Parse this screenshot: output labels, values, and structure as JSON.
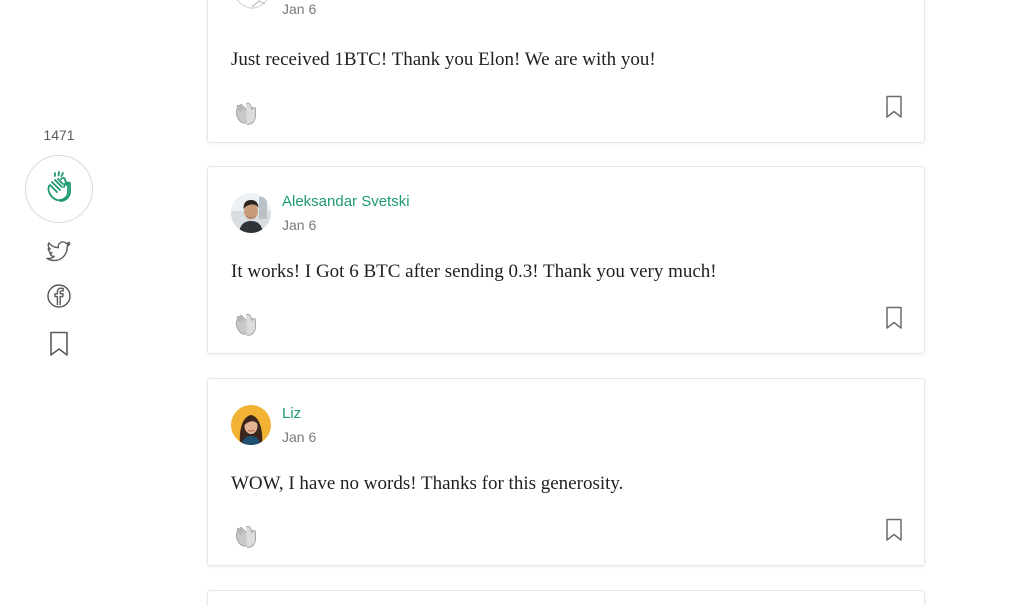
{
  "rail": {
    "clap_count": "1471",
    "clap_icon": "clap-icon",
    "share_icons": [
      "twitter-icon",
      "facebook-icon",
      "bookmark-icon"
    ],
    "accent_color": "#1d9b6e"
  },
  "responses": [
    {
      "author": "",
      "date": "Jan 6",
      "text": "Just received 1BTC! Thank you Elon! We are with you!"
    },
    {
      "author": "Aleksandar Svetski",
      "date": "Jan 6",
      "text": "It works! I Got 6 BTC after sending 0.3! Thank you very much!"
    },
    {
      "author": "Liz",
      "date": "Jan 6",
      "text": "WOW, I have no words! Thanks for this generosity."
    }
  ],
  "colors": {
    "author_name": "#1d9b6e",
    "date": "#7a7a7a",
    "body": "#1f1f1f",
    "card_border": "#e6e6e6"
  }
}
